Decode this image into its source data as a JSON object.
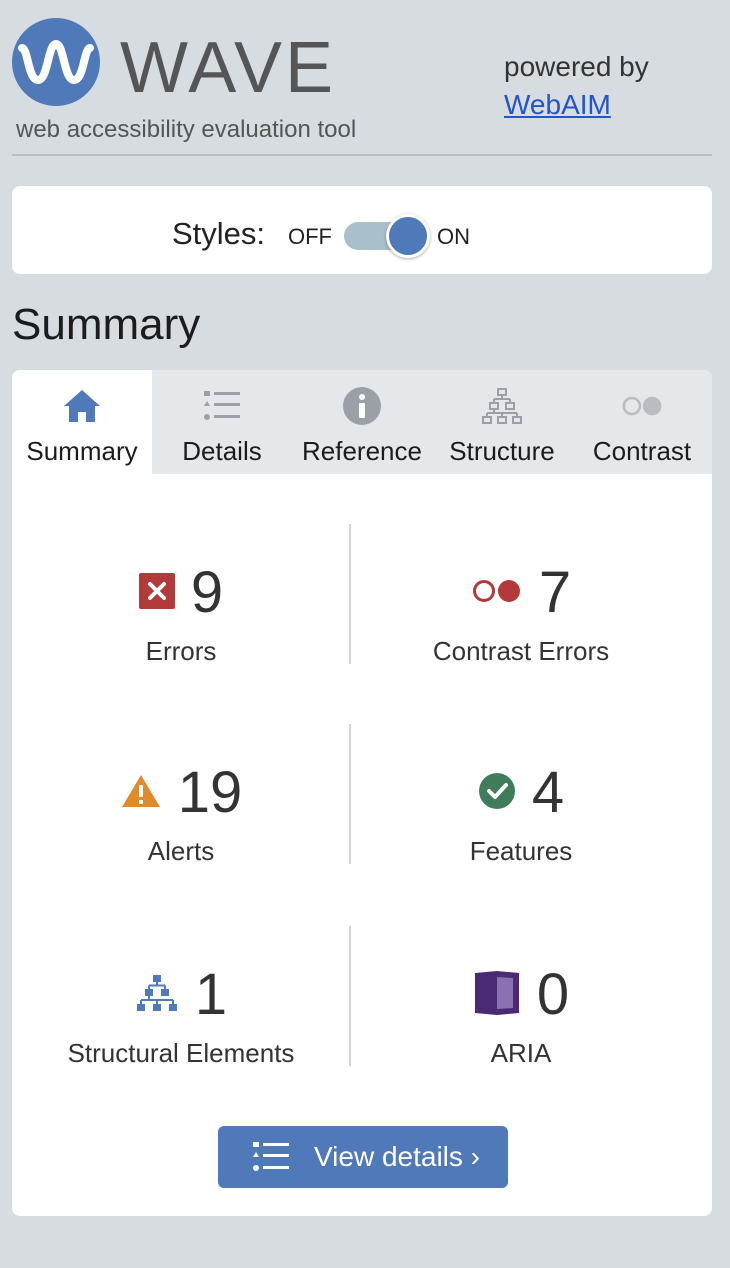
{
  "header": {
    "logo_text": "WAVE",
    "tagline": "web accessibility evaluation tool",
    "powered_by": "powered by",
    "webaim_link": "WebAIM"
  },
  "styles_toggle": {
    "label": "Styles:",
    "off_label": "OFF",
    "on_label": "ON",
    "state": "on"
  },
  "summary_heading": "Summary",
  "tabs": [
    {
      "label": "Summary",
      "icon": "home-icon",
      "active": true
    },
    {
      "label": "Details",
      "icon": "list-icon",
      "active": false
    },
    {
      "label": "Reference",
      "icon": "info-icon",
      "active": false
    },
    {
      "label": "Structure",
      "icon": "structure-icon",
      "active": false
    },
    {
      "label": "Contrast",
      "icon": "contrast-icon",
      "active": false
    }
  ],
  "metrics": {
    "errors": {
      "count": "9",
      "label": "Errors",
      "icon": "error-icon"
    },
    "contrast_errors": {
      "count": "7",
      "label": "Contrast Errors",
      "icon": "contrast-error-icon"
    },
    "alerts": {
      "count": "19",
      "label": "Alerts",
      "icon": "alert-icon"
    },
    "features": {
      "count": "4",
      "label": "Features",
      "icon": "feature-check-icon"
    },
    "structural": {
      "count": "1",
      "label": "Structural Elements",
      "icon": "structure-icon"
    },
    "aria": {
      "count": "0",
      "label": "ARIA",
      "icon": "aria-icon"
    }
  },
  "view_details_button": "View details ›",
  "colors": {
    "accent": "#4f79b9",
    "error": "#b33a3a",
    "alert": "#e08a2c",
    "feature": "#3f7d5a",
    "aria": "#4a2a73",
    "background": "#d6dce0"
  }
}
